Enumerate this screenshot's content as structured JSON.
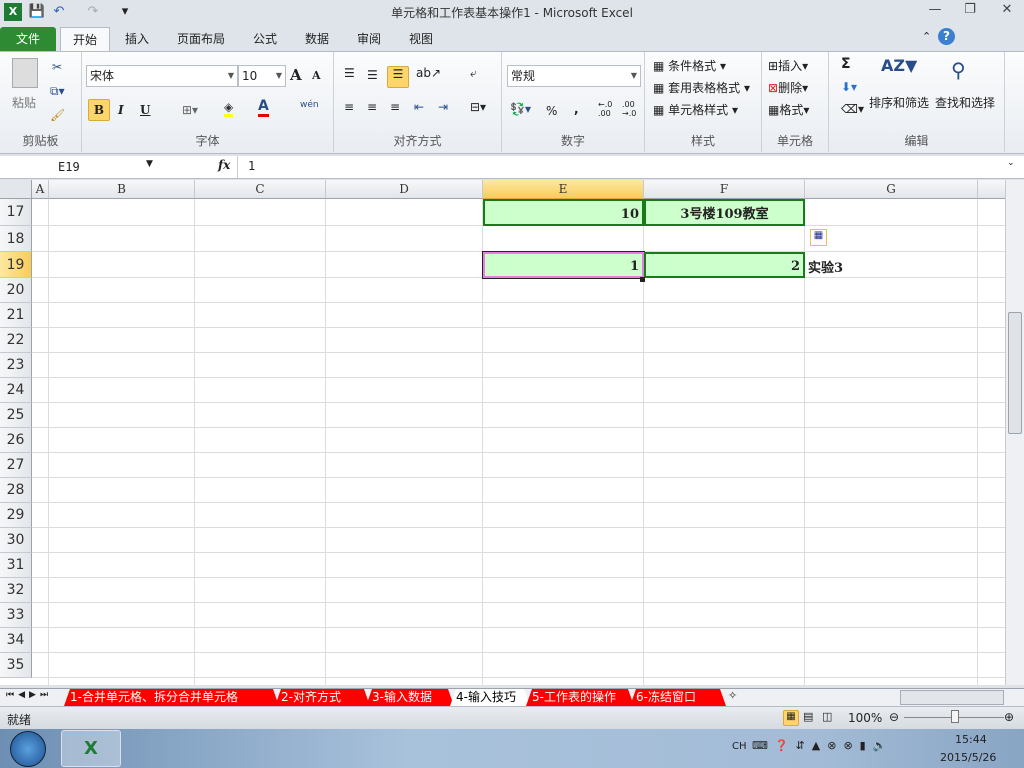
{
  "window": {
    "title": "单元格和工作表基本操作1  -  Microsoft Excel",
    "minimize": "—",
    "restore": "❐",
    "close": "✕"
  },
  "quick_access": {
    "save": "💾",
    "undo": "↶",
    "redo": "↷",
    "customize": "▾"
  },
  "ribbon_tabs": [
    "文件",
    "开始",
    "插入",
    "页面布局",
    "公式",
    "数据",
    "审阅",
    "视图"
  ],
  "ribbon": {
    "clipboard": {
      "label": "剪贴板",
      "paste": "粘贴"
    },
    "font": {
      "label": "字体",
      "name": "宋体",
      "size": "10",
      "bold": "B",
      "italic": "I",
      "underline": "U",
      "grow": "A",
      "shrink": "A",
      "wen": "wén"
    },
    "alignment": {
      "label": "对齐方式"
    },
    "number": {
      "label": "数字",
      "format": "常规",
      "percent": "%",
      "comma": ",",
      "inc": "←.0 .00",
      "dec": ".00 →.0"
    },
    "styles": {
      "label": "样式",
      "conditional": "条件格式",
      "table": "套用表格格式",
      "cell": "单元格样式"
    },
    "cells": {
      "label": "单元格",
      "insert": "插入",
      "delete": "删除",
      "format": "格式"
    },
    "editing": {
      "label": "编辑",
      "sum": "Σ",
      "sort": "排序和筛选",
      "find": "查找和选择"
    }
  },
  "formula_bar": {
    "name_box": "E19",
    "fx": "fx",
    "value": "1"
  },
  "columns": [
    "A",
    "B",
    "C",
    "D",
    "E",
    "F",
    "G"
  ],
  "rows": [
    "17",
    "18",
    "19",
    "20",
    "21",
    "22",
    "23",
    "24",
    "25",
    "26",
    "27",
    "28",
    "29",
    "30",
    "31",
    "32",
    "33",
    "34",
    "35"
  ],
  "cells": {
    "E17": "10",
    "F17": "3号楼109教室",
    "E19": "1",
    "F19": "2",
    "G19": "实验3"
  },
  "sheet_tabs": [
    "1-合并单元格、拆分合并单元格",
    "2-对齐方式",
    "3-输入数据",
    "4-输入技巧",
    "5-工作表的操作",
    "6-冻结窗口"
  ],
  "active_sheet": "4-输入技巧",
  "status": {
    "mode": "就绪",
    "zoom": "100%"
  },
  "taskbar": {
    "lang": "CH",
    "time": "15:44",
    "date": "2015/5/26"
  },
  "colors": {
    "file_tab": "#2f8a34",
    "fill": "#ccffcc",
    "border": "#1a7a1a",
    "tab_red": "#ff0000"
  }
}
